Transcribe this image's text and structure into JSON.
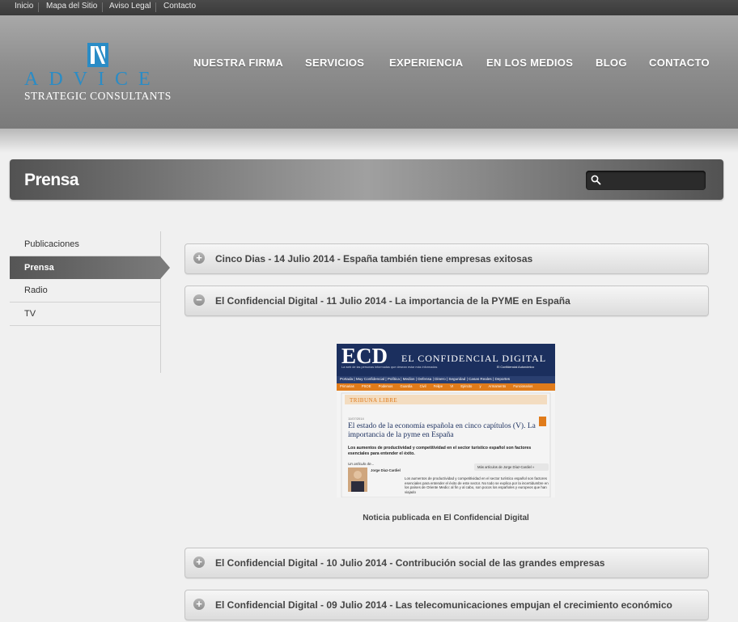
{
  "top_links": [
    "Inicio",
    "Mapa del Sitio",
    "Aviso Legal",
    "Contacto"
  ],
  "logo": {
    "main": "ADVICE",
    "sub": "STRATEGIC CONSULTANTS"
  },
  "nav": [
    "NUESTRA FIRMA",
    "SERVICIOS",
    "EXPERIENCIA",
    "EN LOS MEDIOS",
    "BLOG",
    "CONTACTO"
  ],
  "page_title": "Prensa",
  "search": {
    "placeholder": "",
    "value": ""
  },
  "sidebar": [
    {
      "label": "Publicaciones",
      "active": false
    },
    {
      "label": "Prensa",
      "active": true
    },
    {
      "label": "Radio",
      "active": false
    },
    {
      "label": "TV",
      "active": false
    }
  ],
  "articles": [
    {
      "title": "Cinco Dias - 14 Julio 2014 - España también tiene empresas exitosas",
      "expanded": false,
      "icon": "plus-icon"
    },
    {
      "title": "El Confidencial Digital - 11 Julio 2014 - La importancia de la PYME en España",
      "expanded": true,
      "icon": "minus-icon"
    },
    {
      "title": "El Confidencial Digital - 10 Julio 2014 - Contribución social de las grandes empresas",
      "expanded": false,
      "icon": "plus-icon"
    },
    {
      "title": "El Confidencial Digital - 09 Julio 2014 - Las telecomunicaciones empujan el crecimiento económico",
      "expanded": false,
      "icon": "plus-icon"
    }
  ],
  "clipping": {
    "brand": "ECD",
    "masthead": "EL CONFIDENCIAL DIGITAL",
    "tagline": "La web de las personas informadas que desean estar más informadas",
    "section_tag": "El Confidencial Autonómico",
    "menu": [
      "Portada",
      "Muy Confidencial",
      "Política",
      "Medios",
      "Defensa",
      "Dinero",
      "Seguridad",
      "Casas Reales",
      "Deportes"
    ],
    "submenu": [
      "Primarias PSOE",
      "Podemos",
      "Guardia Civil",
      "Felipe VI",
      "Ejército y Armamento",
      "Funcionarios"
    ],
    "section": "TRIBUNA LIBRE",
    "date": "11/07/2014",
    "headline": "El estado de la economía española en cinco capítulos (V). La importancia de la pyme en España",
    "subhead": "Los aumentos de productividad y competitividad en el sector turístico español son factores esenciales para entender el éxito.",
    "byline_intro": "Un artículo de...",
    "author": "Jorge Díaz-Cardiel",
    "more_link": "Más artículos de Jorge Díaz-Cardiel »",
    "body": "Los aumentos de productividad y competitividad en el sector turístico español son factores esenciales para entender el éxito de este sector. No todo se explica por la incertidumbre en los países de Oriente Medio: al fin y al cabo, son pocos los españoles y europeos que han viajado"
  },
  "caption": "Noticia publicada en El Confidencial Digital",
  "colors": {
    "logo_blue": "#2a8cc6",
    "ecd_orange": "#e07b1a",
    "ecd_navy": "#1b2f5e"
  }
}
